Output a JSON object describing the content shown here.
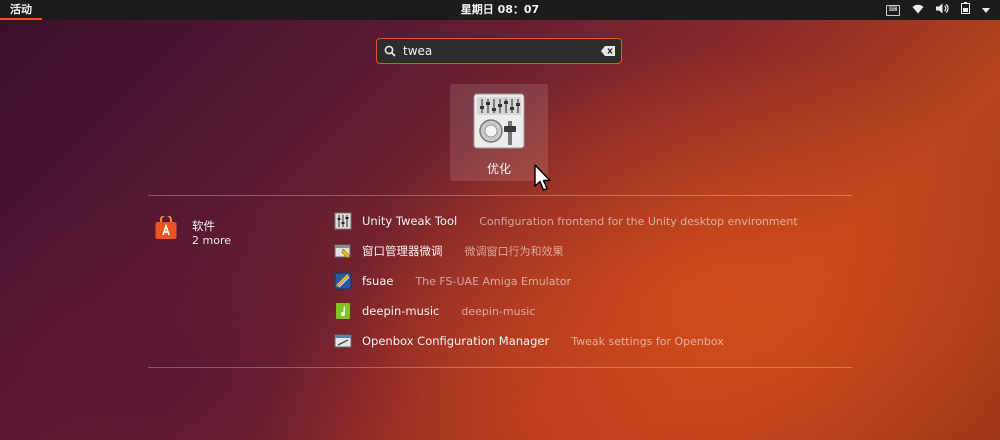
{
  "topbar": {
    "activities": "活动",
    "clock": "星期日 08：07",
    "tray_icons": [
      "keyboard-icon",
      "wifi-icon",
      "volume-icon",
      "battery-icon",
      "chevron-down-icon"
    ]
  },
  "search": {
    "value": "twea",
    "icon": "search-icon",
    "clear_icon": "clear-icon"
  },
  "top_result": {
    "label": "优化",
    "icon": "tweaks-icon"
  },
  "provider": {
    "name": "软件",
    "more": "2 more",
    "icon": "software-center-icon"
  },
  "results": [
    {
      "name": "Unity Tweak Tool",
      "description": "Configuration frontend for the Unity desktop environment",
      "icon": "unity-tweak-icon"
    },
    {
      "name": "窗口管理器微调",
      "description": "微调窗口行为和效果",
      "icon": "window-tweaks-icon"
    },
    {
      "name": "fsuae",
      "description": "The FS-UAE Amiga Emulator",
      "icon": "fsuae-icon"
    },
    {
      "name": "deepin-music",
      "description": "deepin-music",
      "icon": "deepin-music-icon"
    },
    {
      "name": "Openbox Configuration Manager",
      "description": "Tweak settings for Openbox",
      "icon": "openbox-icon"
    }
  ],
  "colors": {
    "accent": "#e95420",
    "topbar": "#1c1c1c"
  }
}
